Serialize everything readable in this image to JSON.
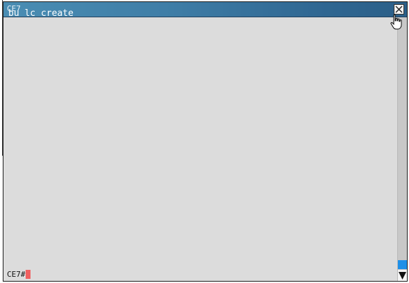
{
  "window": {
    "title": "CE7",
    "title_overlay_text": "bu lc create"
  },
  "terminal": {
    "prompt": "CE7#",
    "caret_color": "#f06060"
  },
  "colors": {
    "titlebar_start": "#4a8db3",
    "titlebar_end": "#2b5f88",
    "terminal_bg": "#dcdcdc",
    "scroll_thumb": "#1e90e8"
  },
  "scrollbar": {
    "position_fraction": 1.0
  },
  "icons": {
    "close": "close-icon",
    "scroll_down": "arrow-down-icon",
    "cursor": "hand-pointer-icon"
  }
}
